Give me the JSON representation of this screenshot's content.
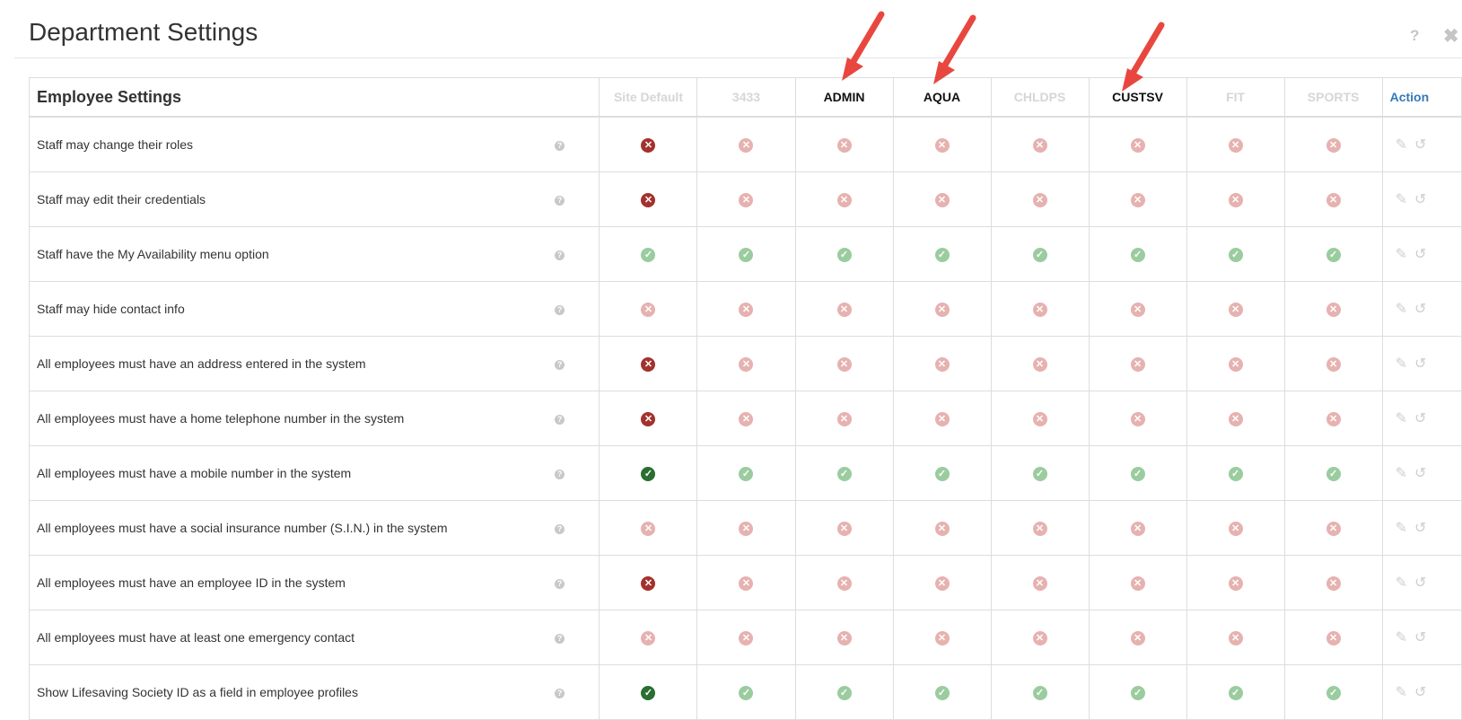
{
  "modal": {
    "title": "Department Settings",
    "help_glyph": "?",
    "close_glyph": "✖"
  },
  "table": {
    "section_title": "Employee Settings",
    "columns": [
      {
        "label": "Site Default",
        "style": "dim"
      },
      {
        "label": "3433",
        "style": "dim"
      },
      {
        "label": "ADMIN",
        "style": "dark"
      },
      {
        "label": "AQUA",
        "style": "dark"
      },
      {
        "label": "CHLDPS",
        "style": "dim"
      },
      {
        "label": "CUSTSV",
        "style": "dark"
      },
      {
        "label": "FIT",
        "style": "dim"
      },
      {
        "label": "SPORTS",
        "style": "dim"
      }
    ],
    "action_label": "Action",
    "rows": [
      {
        "label": "Staff may change their roles",
        "values": [
          "x-dark",
          "x-light",
          "x-light",
          "x-light",
          "x-light",
          "x-light",
          "x-light",
          "x-light"
        ]
      },
      {
        "label": "Staff may edit their credentials",
        "values": [
          "x-dark",
          "x-light",
          "x-light",
          "x-light",
          "x-light",
          "x-light",
          "x-light",
          "x-light"
        ]
      },
      {
        "label": "Staff have the My Availability menu option",
        "values": [
          "c-light",
          "c-light",
          "c-light",
          "c-light",
          "c-light",
          "c-light",
          "c-light",
          "c-light"
        ]
      },
      {
        "label": "Staff may hide contact info",
        "values": [
          "x-light",
          "x-light",
          "x-light",
          "x-light",
          "x-light",
          "x-light",
          "x-light",
          "x-light"
        ]
      },
      {
        "label": "All employees must have an address entered in the system",
        "values": [
          "x-dark",
          "x-light",
          "x-light",
          "x-light",
          "x-light",
          "x-light",
          "x-light",
          "x-light"
        ]
      },
      {
        "label": "All employees must have a home telephone number in the system",
        "values": [
          "x-dark",
          "x-light",
          "x-light",
          "x-light",
          "x-light",
          "x-light",
          "x-light",
          "x-light"
        ]
      },
      {
        "label": "All employees must have a mobile number in the system",
        "values": [
          "c-dark",
          "c-light",
          "c-light",
          "c-light",
          "c-light",
          "c-light",
          "c-light",
          "c-light"
        ]
      },
      {
        "label": "All employees must have a social insurance number (S.I.N.) in the system",
        "values": [
          "x-light",
          "x-light",
          "x-light",
          "x-light",
          "x-light",
          "x-light",
          "x-light",
          "x-light"
        ]
      },
      {
        "label": "All employees must have an employee ID in the system",
        "values": [
          "x-dark",
          "x-light",
          "x-light",
          "x-light",
          "x-light",
          "x-light",
          "x-light",
          "x-light"
        ]
      },
      {
        "label": "All employees must have at least one emergency contact",
        "values": [
          "x-light",
          "x-light",
          "x-light",
          "x-light",
          "x-light",
          "x-light",
          "x-light",
          "x-light"
        ]
      },
      {
        "label": "Show Lifesaving Society ID as a field in employee profiles",
        "values": [
          "c-dark",
          "c-light",
          "c-light",
          "c-light",
          "c-light",
          "c-light",
          "c-light",
          "c-light"
        ]
      }
    ]
  },
  "icons": {
    "help": "?",
    "x_glyph": "✕",
    "check_glyph": "✓",
    "edit_glyph": "✎",
    "history_glyph": "↺",
    "icon_names": [
      "help-icon",
      "close-icon",
      "info-icon",
      "x-circle-icon",
      "check-circle-icon",
      "pencil-icon",
      "history-icon",
      "red-arrow-annotation"
    ]
  },
  "colors": {
    "x_dark": "#a3312d",
    "x_light": "#e6b2b0",
    "check_dark": "#2b6e32",
    "check_light": "#9bcc9f",
    "arrow": "#e8473f",
    "action_link": "#337ab7"
  }
}
